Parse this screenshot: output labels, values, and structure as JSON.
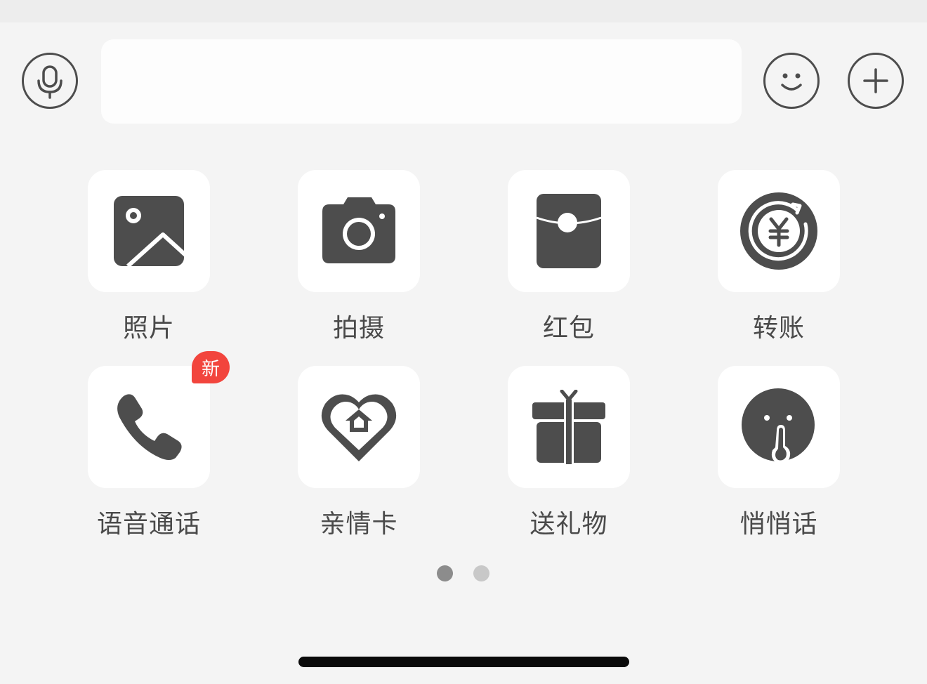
{
  "input_bar": {
    "voice_icon": "microphone-icon",
    "text_value": "",
    "text_placeholder": "",
    "emoji_icon": "smiley-icon",
    "more_icon": "plus-icon"
  },
  "panel": {
    "items": [
      {
        "label": "照片",
        "icon": "photo-icon",
        "badge": ""
      },
      {
        "label": "拍摄",
        "icon": "camera-icon",
        "badge": ""
      },
      {
        "label": "红包",
        "icon": "red-packet-icon",
        "badge": ""
      },
      {
        "label": "转账",
        "icon": "transfer-icon",
        "badge": ""
      },
      {
        "label": "语音通话",
        "icon": "phone-icon",
        "badge": "新"
      },
      {
        "label": "亲情卡",
        "icon": "family-card-icon",
        "badge": ""
      },
      {
        "label": "送礼物",
        "icon": "gift-icon",
        "badge": ""
      },
      {
        "label": "悄悄话",
        "icon": "whisper-icon",
        "badge": ""
      }
    ]
  },
  "pagination": {
    "total_pages": 2,
    "current_page": 1,
    "active_color": "#8c8c8c",
    "inactive_color": "#c8c8c8"
  },
  "colors": {
    "icon": "#4d4d4d",
    "background": "#f4f4f4",
    "tile": "#ffffff",
    "badge": "#f2453d"
  }
}
